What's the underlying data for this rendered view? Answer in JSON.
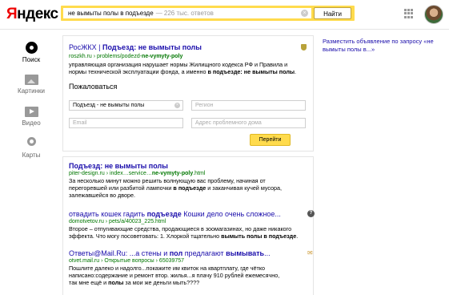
{
  "header": {
    "logo_first": "Я",
    "logo_rest": "ндекс",
    "query": "не вымыты полы в подъезде",
    "result_count": "— 226 тыс. ответов",
    "find_button": "Найти"
  },
  "nav": {
    "search": "Поиск",
    "images": "Картинки",
    "video": "Видео",
    "maps": "Карты"
  },
  "card": {
    "title_plain": "РосЖКХ | ",
    "title_bold": "Подъезд: не вымыты полы",
    "url_plain": "roszkh.ru › problems/podezd-",
    "url_bold": "ne-vymyty-poly",
    "snippet_line1": "управляющая организация нарушает нормы Жилищного кодекса РФ и Правила и",
    "snippet_line2_plain": "нормы технической эксплуатации фонда, а именно ",
    "snippet_line2_bold": "в подъезде: не вымыты полы",
    "snippet_line2_end": ".",
    "complain_heading": "Пожаловаться",
    "field_subject": "Подъезд - не вымыты полы",
    "field_region_placeholder": "Регион",
    "field_email_placeholder": "Email",
    "field_address_placeholder": "Адрес проблемного дома",
    "go_button": "Перейти"
  },
  "ad_link": "Разместить объявление по запросу «не вымыты полы в...»",
  "results": [
    {
      "title_bold": "Подъезд: не вымыты полы",
      "url_plain": "piter-design.ru › index…service…",
      "url_bold": "ne-vymyty-poly",
      "url_end": ".html",
      "snippet1": "За несколько минут можно решить волнующую вас проблему, начиная от",
      "snippet2_plain": "перегоревшей или разбитой лампочки ",
      "snippet2_bold": "в подъезде",
      "snippet2_end": " и заканчивая кучей мусора,",
      "snippet3": "залежавшейся во дворе."
    },
    {
      "title_plain": "отвадить кошек гадить ",
      "title_bold": "подъезде",
      "title_end": " Кошки дело очень сложное...",
      "url": "domotvetov.ru › pets/a/40023_225.html",
      "snippet1": "Второе – отпугивающие средства, продающиеся в зоомагазинах, но даже никакого",
      "snippet2": "эффекта. Что могу посоветовать: 1. Хлоркой тщательно ",
      "snippet2_bold": "вымыть полы в подъезде",
      "snippet2_end": "."
    },
    {
      "title_plain": "Ответы@Mail.Ru: ...а стены и ",
      "title_bold": "пол",
      "title_end": " предлагают ",
      "title_bold2": "вымывать",
      "title_end2": "...",
      "url": "otvet.mail.ru › Открытые вопросы › 65039757",
      "snippet1": "Пошлите далеко и надолго...покажите им квиток на квартплату, где чётко",
      "snippet2": "написано:содержание и ремонт втор. жилья...я плачу 910 рублей ежемесячно,",
      "snippet3_plain": "так мне ещё и ",
      "snippet3_bold": "полы",
      "snippet3_end": " за мои же деньги мыть????"
    }
  ],
  "icons": {
    "clear": "×",
    "question": "?",
    "mail": "✉"
  }
}
